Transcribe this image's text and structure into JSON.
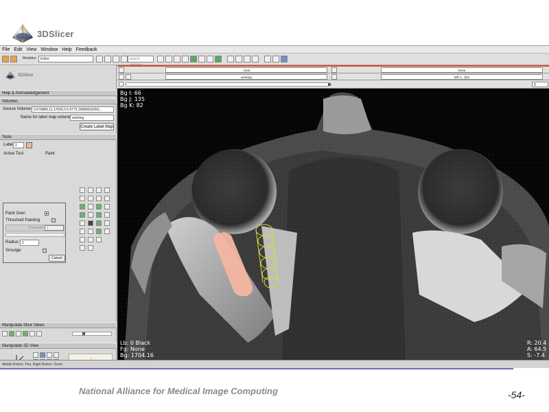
{
  "slide": {
    "logo_text": "3DSlicer",
    "footer": "National Alliance for Medical Image Computing",
    "page_number": "-54-"
  },
  "menu": [
    "File",
    "Edit",
    "View",
    "Window",
    "Help",
    "Feedback"
  ],
  "toolbar": {
    "modules_label": "Modules:",
    "module_value": "Editor",
    "search_placeholder": "search modules"
  },
  "left_panel": {
    "logo_text": "3DSlicer",
    "sections": {
      "help": "Help & Acknowledgement",
      "volumes": "Volumes",
      "tools": "Tools",
      "manipulate_slice_views": "Manipulate Slice Views",
      "manipulate_3d_view": "Manipulate 3D View"
    },
    "source_volume_label": "Source Volume:",
    "source_volume_value": "3.676889.11.17035.5.0.5772.20080610091...",
    "label_map_name_label": "Name for label map volume:",
    "label_map_name_value": "working",
    "create_label_map_button": "Create Label Map",
    "label_label": "Label",
    "label_value": "2",
    "active_tool_label": "Active Tool",
    "active_tool_value": "Paint",
    "paint_over_label": "Paint Over:",
    "paint_over_checked": true,
    "threshold_painting_label": "Threshold Painting",
    "threshold_painting_checked": false,
    "threshold_label": "Threshold",
    "threshold_value": "1",
    "radius_label": "Radius:",
    "radius_value": "2",
    "smudge_label": "Smudge:",
    "smudge_checked": false,
    "cancel_button": "Cancel",
    "zoom_value": "100"
  },
  "viewer": {
    "orientation": "Axial",
    "fg_selector": "None",
    "label_layer": "working",
    "bg_volume": "MR 1.. (tho",
    "slice_value": "8",
    "overlay_top_left": [
      "Bg I: 66",
      "Bg J: 135",
      "Bg K: 82"
    ],
    "overlay_bottom_left": [
      "Lb: 0 Black",
      "Fg: None",
      "Bg: 1704.16"
    ],
    "overlay_bottom_right": [
      "R: 20.4",
      "A: 64.5",
      "S: -7.4"
    ],
    "colors": {
      "label_paint": "#f4b6a1",
      "fiber_outline": "#d9dd3a",
      "header_accent": "#d44a2c"
    }
  },
  "status": {
    "mouse_hint": "Middle Button: Pan, Right Button: Zoom"
  }
}
